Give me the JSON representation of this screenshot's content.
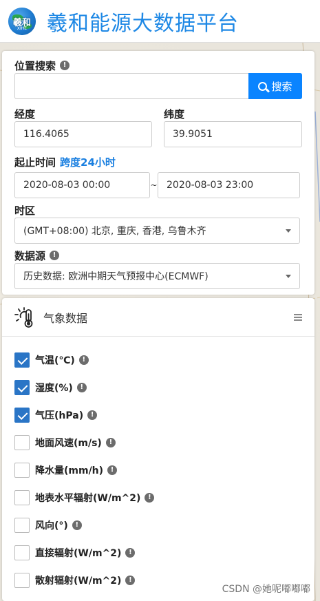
{
  "header": {
    "logo_text": "羲和",
    "logo_sub": "XIHE",
    "title": "羲和能源大数据平台"
  },
  "location": {
    "label": "位置搜索",
    "search_value": "",
    "search_button": "搜索"
  },
  "coords": {
    "longitude_label": "经度",
    "longitude_value": "116.4065",
    "latitude_label": "纬度",
    "latitude_value": "39.9051"
  },
  "time_range": {
    "label": "起止时间",
    "span_label": "跨度24小时",
    "start": "2020-08-03 00:00",
    "separator": "~",
    "end": "2020-08-03 23:00"
  },
  "timezone": {
    "label": "时区",
    "value": "(GMT+08:00) 北京, 重庆, 香港, 乌鲁木齐"
  },
  "datasource": {
    "label": "数据源",
    "value": "历史数据: 欧洲中期天气预报中心(ECMWF)"
  },
  "weather_panel": {
    "title": "气象数据",
    "items": [
      {
        "label": "气温(℃)",
        "checked": true
      },
      {
        "label": "湿度(%)",
        "checked": true
      },
      {
        "label": "气压(hPa)",
        "checked": true
      },
      {
        "label": "地面风速(m/s)",
        "checked": false
      },
      {
        "label": "降水量(mm/h)",
        "checked": false
      },
      {
        "label": "地表水平辐射(W/m^2)",
        "checked": false
      },
      {
        "label": "风向(°)",
        "checked": false
      },
      {
        "label": "直接辐射(W/m^2)",
        "checked": false
      },
      {
        "label": "散射辐射(W/m^2)",
        "checked": false
      }
    ]
  },
  "watermark": "CSDN @她呢嘟嘟嘟",
  "colors": {
    "brand_blue": "#1e88e5",
    "button_blue": "#0a84ff",
    "checkbox_blue": "#2a75c6",
    "accent_blue": "#1a7fe0"
  }
}
